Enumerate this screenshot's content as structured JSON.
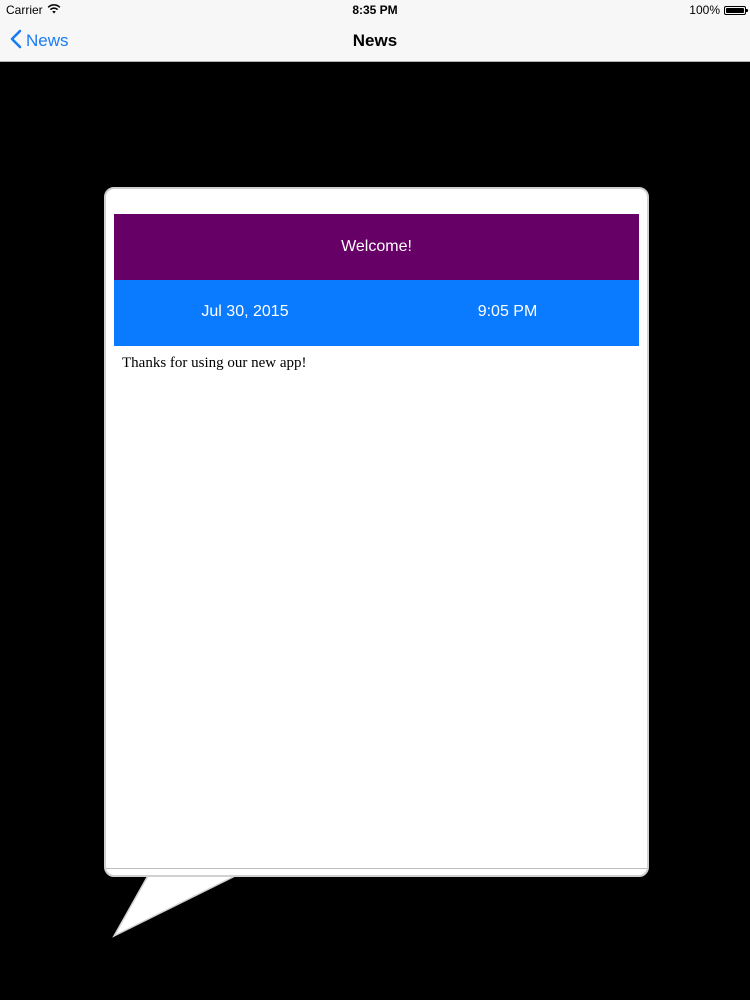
{
  "status_bar": {
    "carrier": "Carrier",
    "time": "8:35 PM",
    "battery": "100%"
  },
  "nav": {
    "back_label": "News",
    "title": "News"
  },
  "news": {
    "headline": "Welcome!",
    "date": "Jul 30, 2015",
    "time": "9:05 PM",
    "body": "Thanks for using our new app!"
  },
  "colors": {
    "background": "#000000",
    "headline_bar": "#660066",
    "date_bar": "#0a7aff",
    "accent": "#1a7cf5"
  },
  "icons": [
    "wifi-icon",
    "battery-icon",
    "chevron-left-icon"
  ]
}
